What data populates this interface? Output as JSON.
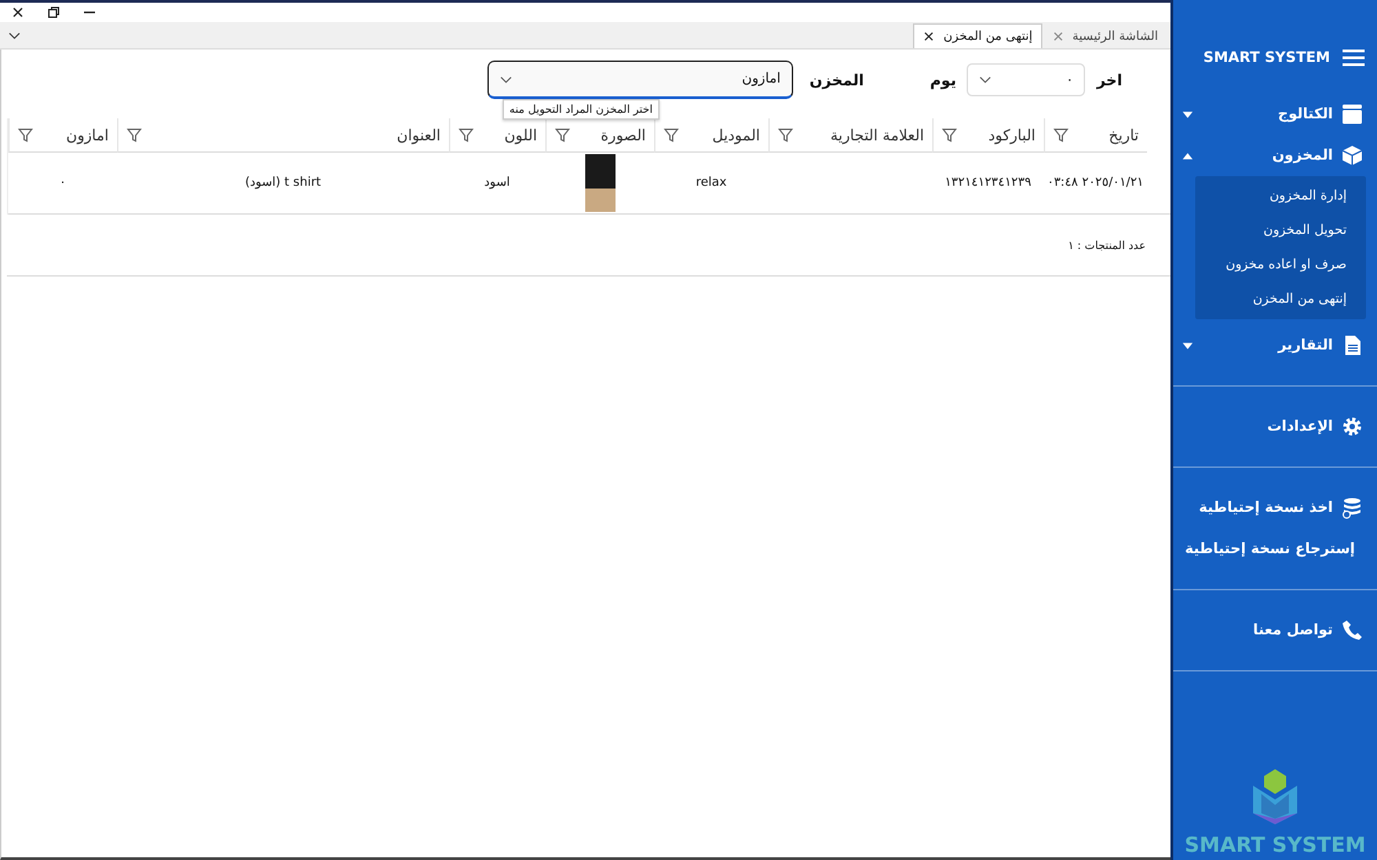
{
  "tabs": [
    {
      "label": "الشاشة الرئيسية",
      "selected": false
    },
    {
      "label": "إنتهى من المخزن",
      "selected": true
    }
  ],
  "filters": {
    "last_label": "اخر",
    "days_value": "٠",
    "days_unit": "يوم",
    "store_label": "المخزن",
    "store_value": "امازون",
    "store_tooltip": "اختر المخزن المراد التحويل منه"
  },
  "table": {
    "columns": [
      "تاريخ",
      "الباركود",
      "العلامة التجارية",
      "الموديل",
      "الصورة",
      "اللون",
      "العنوان",
      "امازون"
    ],
    "rows": [
      {
        "cells": [
          {
            "kind": "datetime",
            "text": "٢٠٢٥/٠١/٢١ ٠٣:٤٨"
          },
          {
            "kind": "text",
            "text": "١٣٢١٤١٢٣٤١٢٣٩"
          },
          {
            "kind": "empty"
          },
          {
            "kind": "text",
            "text": "relax"
          },
          {
            "kind": "photo"
          },
          {
            "kind": "text",
            "text": "اسود"
          },
          {
            "kind": "text",
            "text": "t shirt (اسود)"
          },
          {
            "kind": "text",
            "text": "٠"
          }
        ]
      }
    ]
  },
  "product_count": "عدد المنتجات : ١",
  "sidebar": {
    "title": "SMART SYSTEM",
    "groups": [
      [
        {
          "label": "الكتالوج",
          "expanded": false
        },
        {
          "label": "المخزون",
          "expanded": true,
          "children": [
            {
              "label": "إدارة المخزون"
            },
            {
              "label": "تحويل المخزون"
            },
            {
              "label": "صرف او اعاده مخزون"
            },
            {
              "label": "إنتهى من المخزن"
            }
          ]
        },
        {
          "label": "التقارير",
          "expanded": false
        }
      ],
      [
        {
          "label": "الإعدادات"
        }
      ],
      [
        {
          "label": "اخذ نسخة إحتياطية"
        },
        {
          "label": "إسترجاع نسخة إحتياطية"
        }
      ],
      [
        {
          "label": "تواصل معنا"
        }
      ]
    ],
    "brand": "SMART SYSTEM"
  }
}
